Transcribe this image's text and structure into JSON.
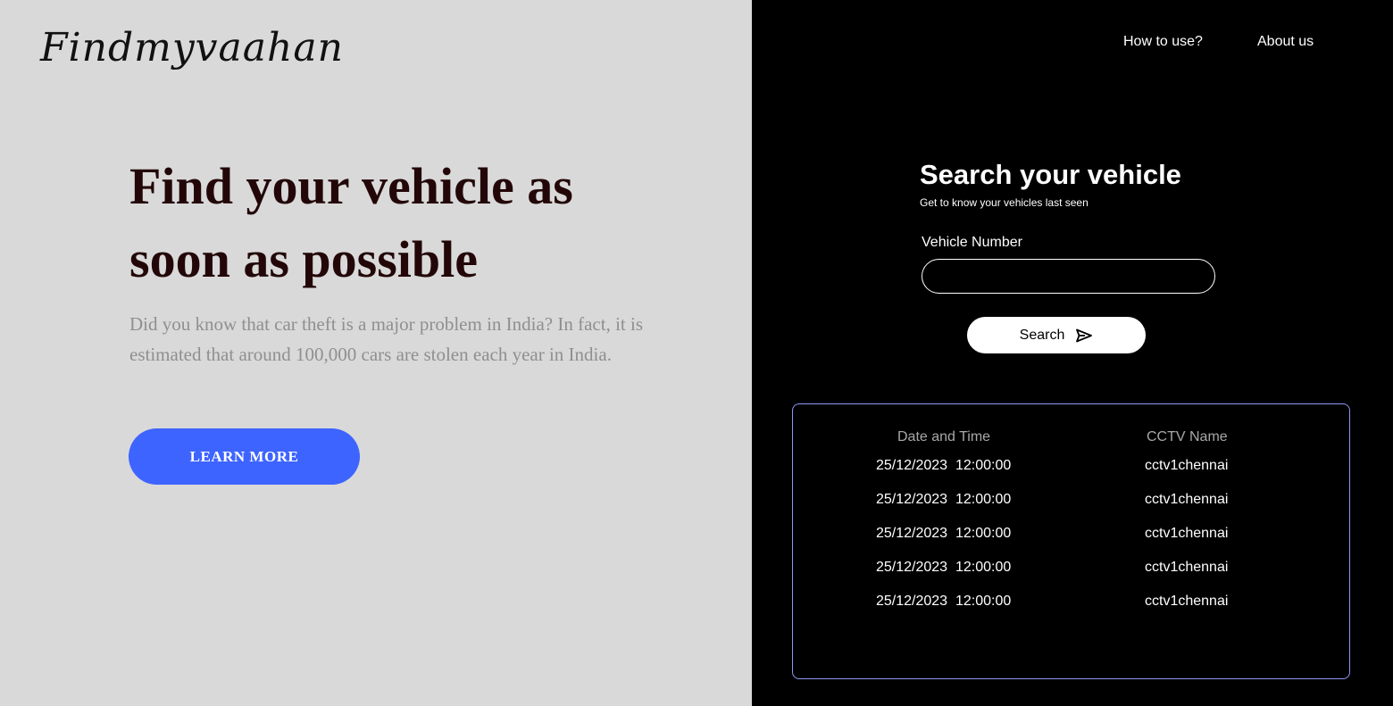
{
  "brand": {
    "logo_text": "Findmyvaahan"
  },
  "nav": {
    "how_to_use": "How to use?",
    "about_us": "About us"
  },
  "hero": {
    "title": "Find your vehicle as soon as possible",
    "description": "Did you know that car theft is a major problem in India? In fact, it is estimated that around 100,000 cars are stolen each year in India.",
    "cta_label": "LEARN MORE"
  },
  "search": {
    "title": "Search your vehicle",
    "subtitle": "Get to know your vehicles last seen",
    "field_label": "Vehicle Number",
    "field_value": "",
    "button_label": "Search"
  },
  "results": {
    "headers": [
      "Date and Time",
      "CCTV Name"
    ],
    "rows": [
      {
        "date_time": "25/12/2023  12:00:00",
        "cctv": "cctv1chennai"
      },
      {
        "date_time": "25/12/2023  12:00:00",
        "cctv": "cctv1chennai"
      },
      {
        "date_time": "25/12/2023  12:00:00",
        "cctv": "cctv1chennai"
      },
      {
        "date_time": "25/12/2023  12:00:00",
        "cctv": "cctv1chennai"
      },
      {
        "date_time": "25/12/2023  12:00:00",
        "cctv": "cctv1chennai"
      }
    ]
  },
  "icons": {
    "search_button_icon": "send-icon"
  },
  "colors": {
    "left_background": "#d9d9d9",
    "right_background": "#000000",
    "accent": "#3e64ff",
    "hero_title": "#230708",
    "table_border": "#8e97f5"
  }
}
